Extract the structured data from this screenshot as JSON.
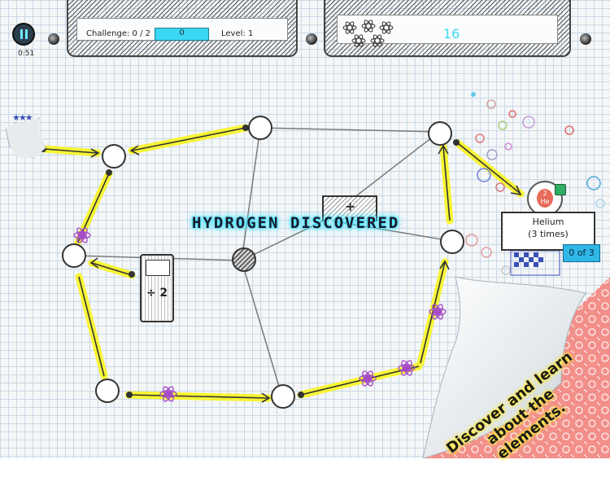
{
  "hud": {
    "timer": "0:51",
    "challenge_label": "Challenge: 0 / 2",
    "challenge_value": "0",
    "challenge_progress": 0,
    "level_label": "Level: 1",
    "atoms_count": "16"
  },
  "board": {
    "banner": "HYDROGEN DISCOVERED",
    "block_label": "÷ 2",
    "plus_label": "+"
  },
  "goal": {
    "element_number": "2",
    "element_symbol": "He",
    "element_name": "Helium",
    "times": "(3 times)",
    "progress": "0 of 3"
  },
  "curl": {
    "line1": "Discover and learn",
    "line2": "about the",
    "line3": "elements."
  },
  "colors": {
    "path_highlight": "#f8f52a",
    "hud_accent": "#3ad8f2",
    "atom_purple": "#a64cc8",
    "goal_badge": "#2fb7e8",
    "curl_bg": "#f28f8a"
  },
  "icons": [
    "pause-icon",
    "bomb-icon",
    "atom-icon",
    "lock-icon",
    "star-icon"
  ]
}
